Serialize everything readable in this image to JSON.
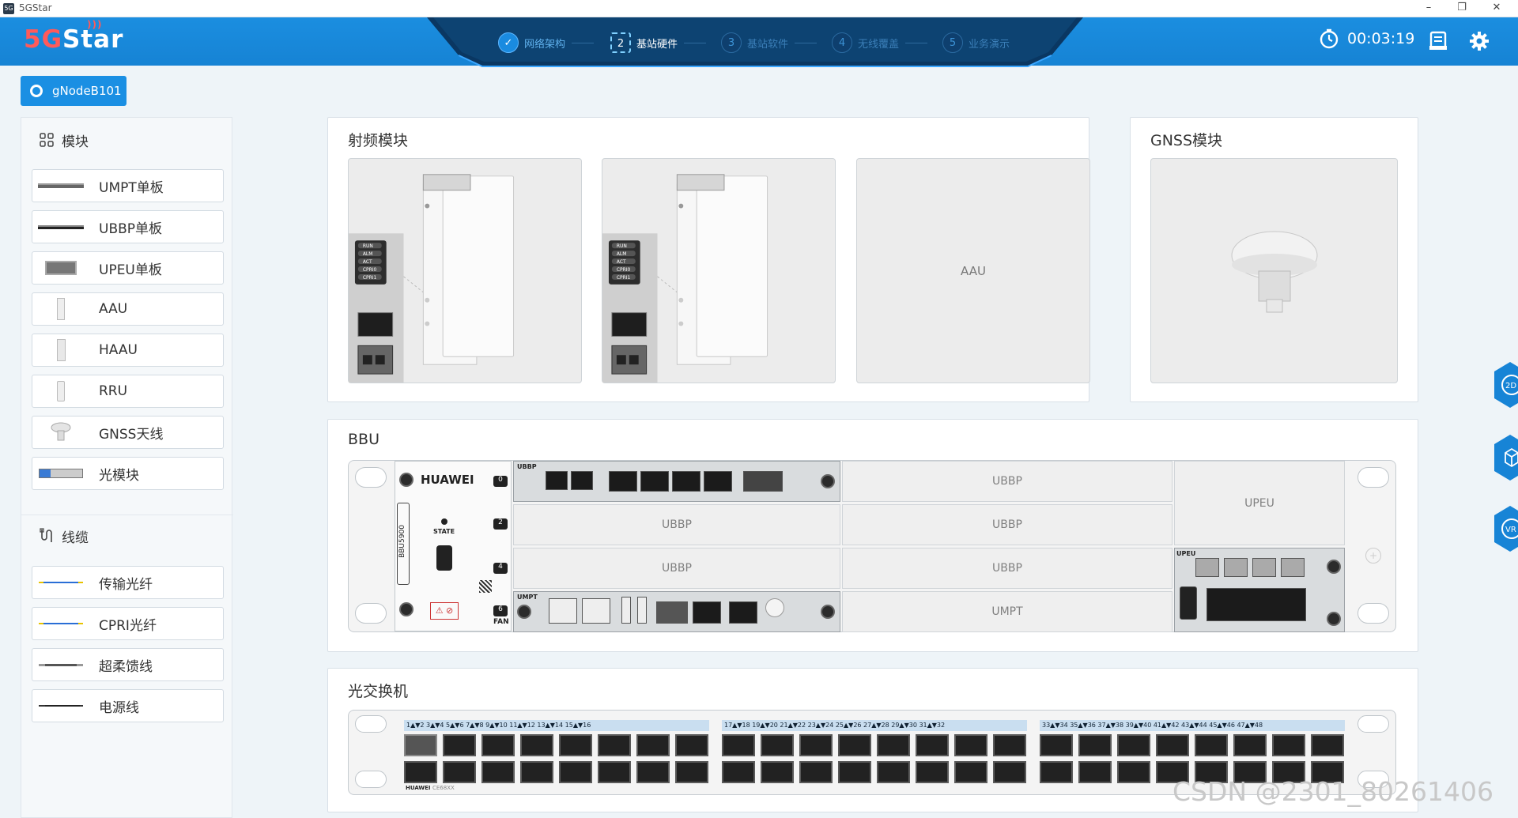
{
  "window": {
    "title": "5GStar",
    "icon_text": "5G",
    "minimize": "–",
    "restore": "❐",
    "close": "✕"
  },
  "header": {
    "logo_text": "5GStar",
    "steps": [
      {
        "num": "✓",
        "label": "网络架构",
        "state": "done"
      },
      {
        "num": "2",
        "label": "基站硬件",
        "state": "active"
      },
      {
        "num": "3",
        "label": "基站软件",
        "state": "todo"
      },
      {
        "num": "4",
        "label": "无线覆盖",
        "state": "todo"
      },
      {
        "num": "5",
        "label": "业务演示",
        "state": "todo"
      }
    ],
    "timer": "00:03:19"
  },
  "node_tab": "gNodeB101",
  "sidebar": {
    "modules_heading": "模块",
    "modules": [
      "UMPT单板",
      "UBBP单板",
      "UPEU单板",
      "AAU",
      "HAAU",
      "RRU",
      "GNSS天线",
      "光模块"
    ],
    "cables_heading": "线缆",
    "cables": [
      "传输光纤",
      "CPRI光纤",
      "超柔馈线",
      "电源线"
    ]
  },
  "rf_panel": {
    "title": "射频模块",
    "empty_slot": "AAU",
    "led_labels": [
      "RUN",
      "ALM",
      "ACT",
      "CPRI0",
      "CPRI1"
    ]
  },
  "gnss_panel": {
    "title": "GNSS模块"
  },
  "bbu_panel": {
    "title": "BBU",
    "brand": "HUAWEI",
    "model": "BBU5900",
    "state_label": "STATE",
    "fan_label": "FAN",
    "slot_numbers": [
      "0",
      "2",
      "4",
      "6"
    ],
    "board_ubbp": "UBBP",
    "board_umpt": "UMPT",
    "board_upeu": "UPEU",
    "empty_slots": {
      "s1": "UBBP",
      "s2": "UBBP",
      "s3": "UBBP",
      "s4": "UBBP",
      "s5": "UBBP",
      "s6": "UMPT",
      "s7": "UPEU"
    }
  },
  "switch_panel": {
    "title": "光交换机",
    "brand": "HUAWEI",
    "model": "CE68XX",
    "port_groups": [
      "1▲▼2  3▲▼4  5▲▼6  7▲▼8  9▲▼10 11▲▼12 13▲▼14 15▲▼16",
      "17▲▼18 19▲▼20 21▲▼22 23▲▼24 25▲▼26 27▲▼28 29▲▼30 31▲▼32",
      "33▲▼34 35▲▼36 37▲▼38 39▲▼40 41▲▼42 43▲▼44 45▲▼46 47▲▼48"
    ]
  },
  "side_buttons": [
    "2D",
    "3D",
    "VR"
  ],
  "watermark": "CSDN @2301_80261406"
}
